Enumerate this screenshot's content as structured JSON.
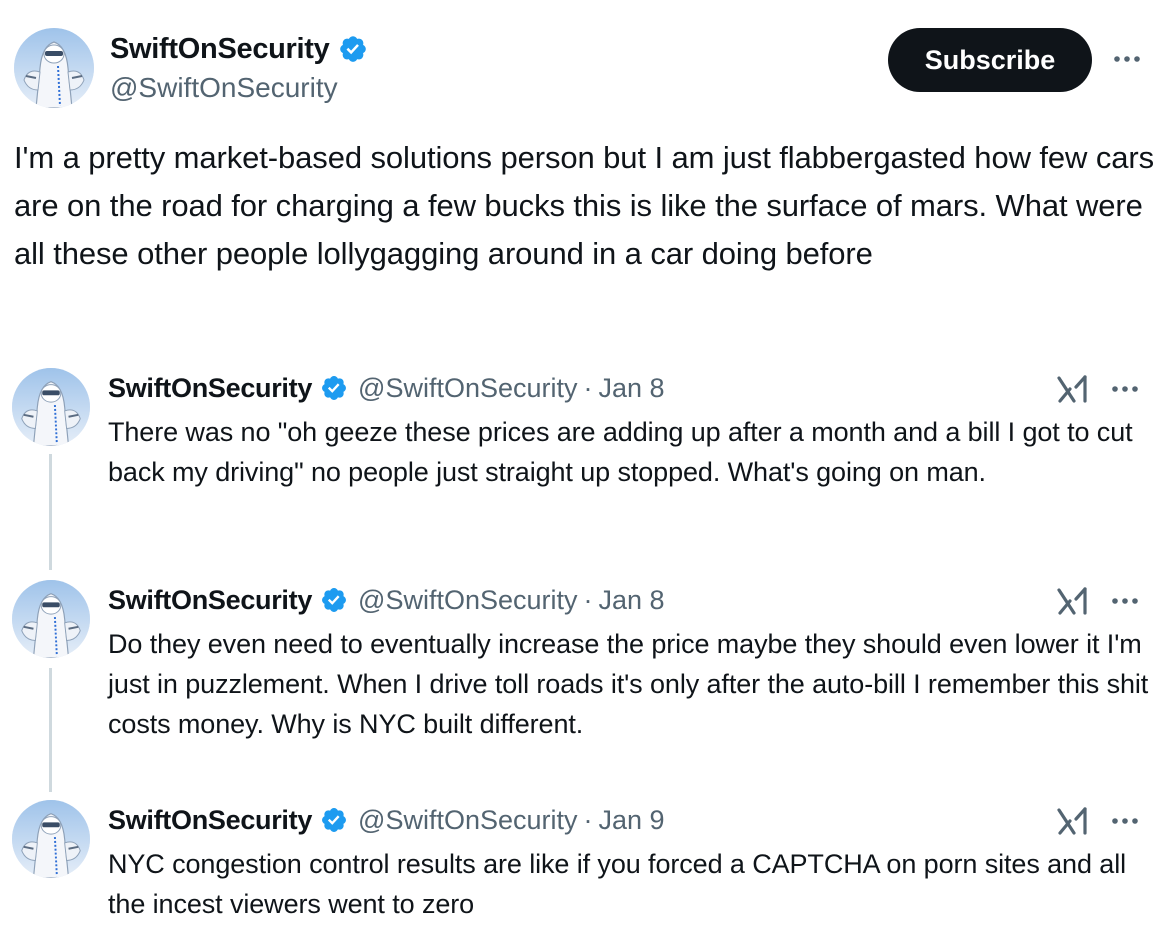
{
  "main_tweet": {
    "display_name": "SwiftOnSecurity",
    "handle": "@SwiftOnSecurity",
    "subscribe_label": "Subscribe",
    "text": "I'm a pretty market-based solutions person but I am just flabbergasted how few cars are on the road for charging a few bucks this is like the surface of mars. What were all these other people lollygagging around in a car doing before"
  },
  "thread": [
    {
      "display_name": "SwiftOnSecurity",
      "handle": "@SwiftOnSecurity",
      "separator": "·",
      "date": "Jan 8",
      "text": "There was no \"oh geeze these prices are adding up after a month and a bill I got to cut back my driving\" no people just straight up stopped. What's going on man."
    },
    {
      "display_name": "SwiftOnSecurity",
      "handle": "@SwiftOnSecurity",
      "separator": "·",
      "date": "Jan 8",
      "text": "Do they even need to eventually increase the price maybe they should even lower it I'm just in puzzlement. When I drive toll roads it's only after the auto-bill I remember this shit costs money. Why is NYC built different."
    },
    {
      "display_name": "SwiftOnSecurity",
      "handle": "@SwiftOnSecurity",
      "separator": "·",
      "date": "Jan 9",
      "text": "NYC congestion control results are like if you forced a CAPTCHA on porn sites and all the incest viewers went to zero"
    }
  ],
  "icons": {
    "verified": "verified-badge-icon",
    "more": "more-horizontal-icon",
    "grok": "grok-icon"
  },
  "colors": {
    "text_primary": "#0f1419",
    "text_secondary": "#536471",
    "verified_blue": "#1d9bf0",
    "button_dark": "#0f1419",
    "thread_line": "#cfd9de"
  }
}
